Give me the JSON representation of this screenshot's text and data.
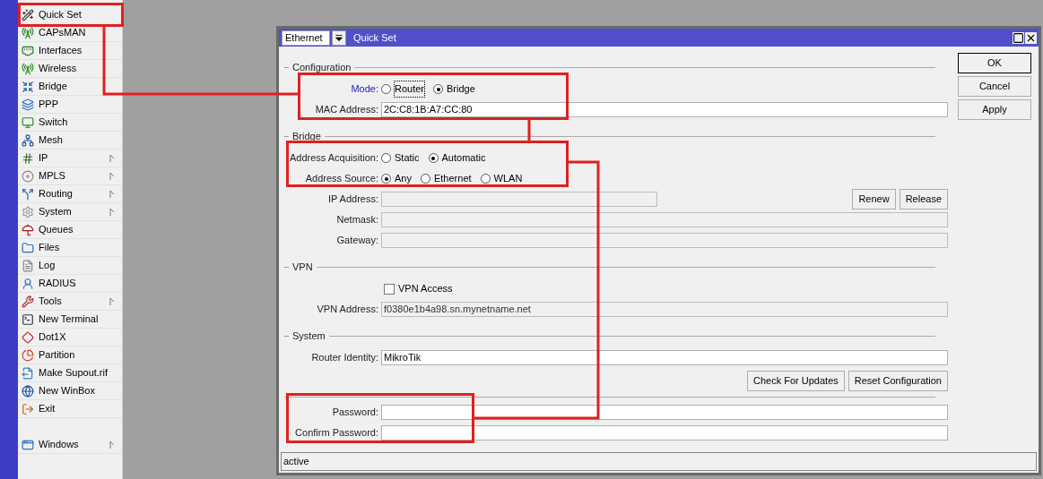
{
  "sidebar": {
    "items": [
      {
        "label": "Quick Set",
        "submenu": false
      },
      {
        "label": "CAPsMAN",
        "submenu": false
      },
      {
        "label": "Interfaces",
        "submenu": false
      },
      {
        "label": "Wireless",
        "submenu": false
      },
      {
        "label": "Bridge",
        "submenu": false
      },
      {
        "label": "PPP",
        "submenu": false
      },
      {
        "label": "Switch",
        "submenu": false
      },
      {
        "label": "Mesh",
        "submenu": false
      },
      {
        "label": "IP",
        "submenu": true
      },
      {
        "label": "MPLS",
        "submenu": true
      },
      {
        "label": "Routing",
        "submenu": true
      },
      {
        "label": "System",
        "submenu": true
      },
      {
        "label": "Queues",
        "submenu": false
      },
      {
        "label": "Files",
        "submenu": false
      },
      {
        "label": "Log",
        "submenu": false
      },
      {
        "label": "RADIUS",
        "submenu": false
      },
      {
        "label": "Tools",
        "submenu": true
      },
      {
        "label": "New Terminal",
        "submenu": false
      },
      {
        "label": "Dot1X",
        "submenu": false
      },
      {
        "label": "Partition",
        "submenu": false
      },
      {
        "label": "Make Supout.rif",
        "submenu": false
      },
      {
        "label": "New WinBox",
        "submenu": false
      },
      {
        "label": "Exit",
        "submenu": false
      }
    ],
    "bottom_item": {
      "label": "Windows",
      "submenu": true
    }
  },
  "window": {
    "interface_select": "Ethernet",
    "title": "Quick Set",
    "status": "active"
  },
  "buttons": [
    {
      "label": "OK",
      "default": true
    },
    {
      "label": "Cancel",
      "default": false
    },
    {
      "label": "Apply",
      "default": false
    }
  ],
  "rows": [
    {
      "kind": "header",
      "label": "Configuration"
    },
    {
      "kind": "radio",
      "label": "Mode:",
      "link": true,
      "options": [
        {
          "label": "Router",
          "selected": false,
          "focused": true
        },
        {
          "label": "Bridge",
          "selected": true,
          "focused": false
        }
      ]
    },
    {
      "kind": "field",
      "label": "MAC Address:",
      "value": "2C:C8:1B:A7:CC:80",
      "disabled": false
    },
    {
      "kind": "header",
      "label": "Bridge"
    },
    {
      "kind": "radio",
      "label": "Address Acquisition:",
      "link": false,
      "options": [
        {
          "label": "Static",
          "selected": false,
          "focused": false
        },
        {
          "label": "Automatic",
          "selected": true,
          "focused": false
        }
      ]
    },
    {
      "kind": "radio",
      "label": "Address Source:",
      "link": false,
      "options": [
        {
          "label": "Any",
          "selected": true,
          "focused": false
        },
        {
          "label": "Ethernet",
          "selected": false,
          "focused": false
        },
        {
          "label": "WLAN",
          "selected": false,
          "focused": false
        }
      ]
    },
    {
      "kind": "field",
      "label": "IP Address:",
      "disabled": true,
      "buttons": [
        "Renew",
        "Release"
      ]
    },
    {
      "kind": "field",
      "label": "Netmask:",
      "disabled": true
    },
    {
      "kind": "field",
      "label": "Gateway:",
      "disabled": true
    },
    {
      "kind": "header",
      "label": "VPN"
    },
    {
      "kind": "checkbox",
      "label": "VPN Access",
      "checked": false
    },
    {
      "kind": "field",
      "label": "VPN Address:",
      "value": "f0380e1b4a98.sn.mynetname.net",
      "disabled": true
    },
    {
      "kind": "header",
      "label": "System"
    },
    {
      "kind": "field",
      "label": "Router Identity:",
      "value": "MikroTik",
      "disabled": false
    },
    {
      "kind": "buttons",
      "buttons": [
        "Check For Updates",
        "Reset Configuration"
      ]
    },
    {
      "kind": "separator"
    },
    {
      "kind": "field",
      "label": "Password:",
      "disabled": false
    },
    {
      "kind": "field",
      "label": "Confirm Password:",
      "disabled": false
    }
  ]
}
